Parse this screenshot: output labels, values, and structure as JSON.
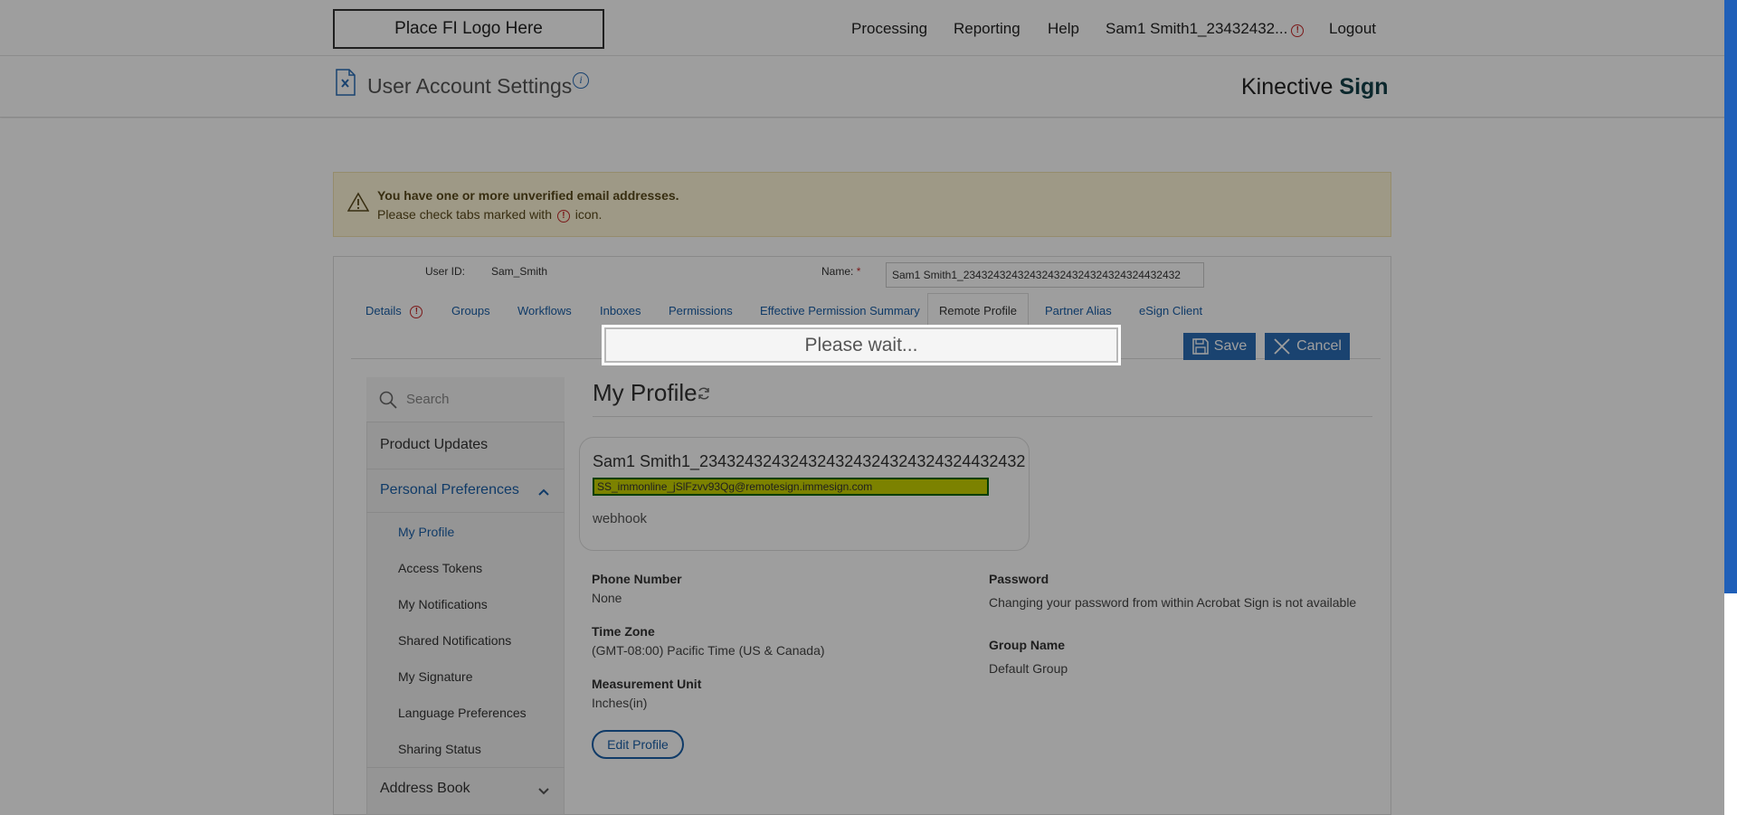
{
  "header": {
    "logo": "Place FI Logo Here",
    "nav": [
      "Processing",
      "Reporting",
      "Help"
    ],
    "user": "Sam1 Smith1_23432432...",
    "alert_mark": "!",
    "logout": "Logout"
  },
  "subheader": {
    "title": "User Account Settings",
    "info_mark": "i",
    "brand_plain": "Kinective ",
    "brand_bold": "Sign"
  },
  "warning": {
    "title": "You have one or more unverified email addresses.",
    "message_before": "Please check tabs marked with",
    "message_after": "icon."
  },
  "account": {
    "user_id_label": "User ID:",
    "user_id": "Sam_Smith",
    "name_label": "Name:",
    "required_mark": "*",
    "name_value": "Sam1 Smith1_234324324324324324324324324324432432"
  },
  "tabs": [
    "Details",
    "Groups",
    "Workflows",
    "Inboxes",
    "Permissions",
    "Effective Permission Summary",
    "Remote Profile",
    "Partner Alias",
    "eSign Client"
  ],
  "actions": {
    "save": "Save",
    "cancel": "Cancel"
  },
  "sidebar": {
    "search_placeholder": "Search",
    "product_updates": "Product Updates",
    "personal_preferences": "Personal Preferences",
    "sub_items": [
      "My Profile",
      "Access Tokens",
      "My Notifications",
      "Shared Notifications",
      "My Signature",
      "Language Preferences",
      "Sharing Status"
    ],
    "address_book": "Address Book"
  },
  "profile": {
    "heading": "My Profile",
    "name": "Sam1 Smith1_234324324324324324324324324324432432",
    "email": "SS_immonline_jSlFzvv93Qg@remotesign.immesign.com",
    "subtitle": "webhook",
    "phone_label": "Phone Number",
    "phone_value": "None",
    "timezone_label": "Time Zone",
    "timezone_value": "(GMT-08:00) Pacific Time (US & Canada)",
    "unit_label": "Measurement Unit",
    "unit_value": "Inches(in)",
    "password_label": "Password",
    "password_value": "Changing your password from within Acrobat Sign is not available",
    "group_label": "Group Name",
    "group_value": "Default Group",
    "edit_button": "Edit Profile"
  },
  "loading": {
    "message": "Please wait..."
  },
  "colors": {
    "accent": "#2b6cb5",
    "link": "#1a5fa8",
    "alert": "#c62828",
    "highlight": "#c8d200"
  }
}
